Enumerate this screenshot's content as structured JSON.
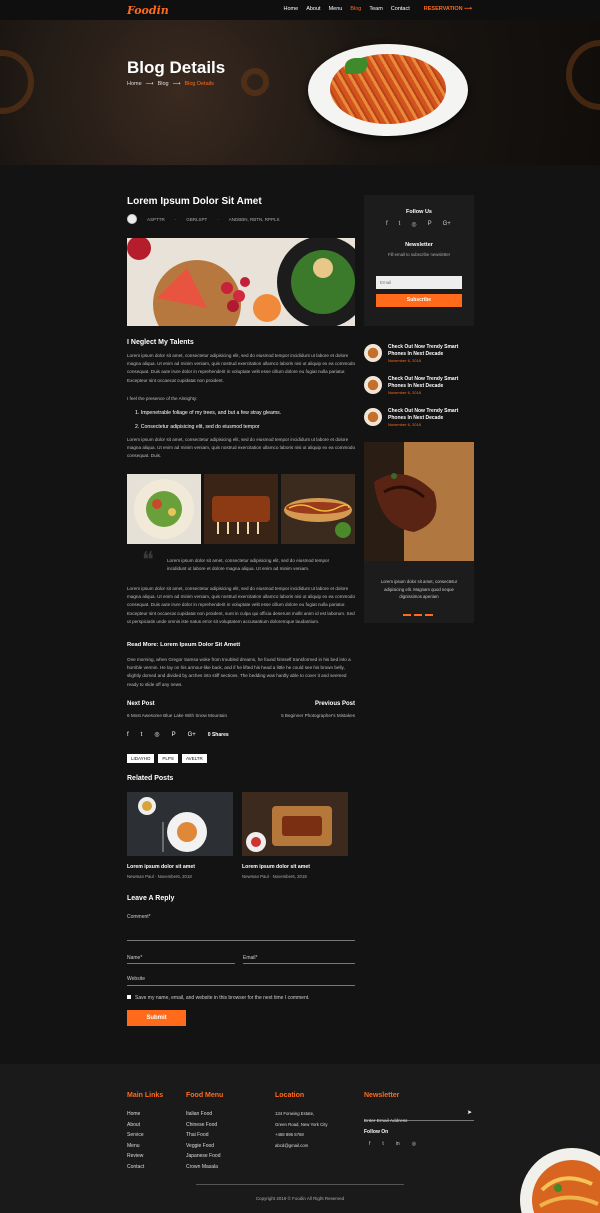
{
  "nav": {
    "logo": "Foodin",
    "links": [
      "Home",
      "About",
      "Menu",
      "Blog",
      "Team",
      "Contact"
    ],
    "active": "Blog",
    "reservation": "RESERVATION ⟶"
  },
  "hero": {
    "title": "Blog Details",
    "breadcrumb": [
      "Home",
      "Blog",
      "Blog Details"
    ]
  },
  "post": {
    "title": "Lorem Ipsum Dolor Sit Amet",
    "meta": [
      "ASPTTR",
      "GBRLSPT",
      "ANDBBN, RBTN, RPPLS"
    ],
    "section_title": "I Neglect My Talents",
    "para1": "Lorem ipsum dolor sit amet, consectetur adipisicing elit, sed do eiusmod tempor incididunt ut labore et dolore magna aliqua. Ut enim ad minim veniam, quis nostrud exercitation ullamco laboris nisi ut aliquip ex ea commodo consequat. Duis aute irure dolor in reprehenderit in voluptate velit esse cillum dolore eu fugiat nulla pariatur. Excepteur sint occaecat cupidatat non proident.",
    "presence": "I feel the presence of the Almighty:",
    "list": [
      "Impenetrable foliage of my trees, and but a few stray gleams.",
      "Consectetur adipisicing elit, sed do eiusmod tempor"
    ],
    "para2": "Lorem ipsum dolor sit amet, consectetur adipisicing elit, sed do eiusmod tempor incididunt ut labore et dolore magna aliqua. Ut enim ad minim veniam, quis nostrud exercitation ullamco laboris nisi ut aliquip ex ea commodo consequat. Duis.",
    "quote": "Lorem ipsum dolor sit amet, consectetur adipisicing elit, sed do eiusmod tempor incididunt ut labore et dolore magna aliqua. Ut enim ad minim veniam.",
    "para3": "Lorem ipsum dolor sit amet, consectetur adipisicing elit, sed do eiusmod tempor incididunt ut labore et dolore magna aliqua. Ut enim ad minim veniam, quis nostrud exercitation ullamco laboris nisi ut aliquip ex ea commodo consequat. Duis aute irure dolor in reprehenderit in voluptate velit esse cillum dolore eu fugiat nulla pariatur. Excepteur sint occaecat cupidatat non proident, sunt in culpa qui officia deserunt mollit anim id est laborum. Sed ut perspiciatis unde omnis iste natus error sit voluptatem accusantium doloremque laudantium.",
    "read_more": "Read More: Lorem Ipsum Dolor Sit Amett",
    "para4": "One morning, when Gregor Samsa woke from troubled dreams, he found himself transformed in his bed into a horrible vermin. He lay on his armour-like back, and if he lifted his head a little he could see his brown belly, slightly domed and divided by arches into stiff sections. The bedding was hardly able to cover it and seemed ready to slide off any news.",
    "next_label": "Next Post",
    "next_title": "6 Most Awesome Blue Lake With Snow Mountain",
    "prev_label": "Previous Post",
    "prev_title": "5 Beginner Photographer's Mistakes",
    "shares": "0 Shares",
    "tags": [
      "LIDAYHO",
      "PLPS",
      "AVELTR"
    ]
  },
  "related": {
    "heading": "Related Posts",
    "items": [
      {
        "title": "Lorem ipsum dolor sit amet",
        "meta": "Newman Paul · November6, 2018"
      },
      {
        "title": "Lorem ipsum dolor sit amet",
        "meta": "Newman Paul · November6, 2018"
      }
    ]
  },
  "reply": {
    "heading": "Leave A Reply",
    "comment": "Comment*",
    "name": "Name*",
    "email": "Email*",
    "website": "Website",
    "save": "Save my name, email, and website in this browser for the next time I comment.",
    "submit": "Submit"
  },
  "sidebar": {
    "follow": "Follow Us",
    "social": [
      "f",
      "t",
      "◎",
      "P",
      "G+"
    ],
    "newsletter": "Newsletter",
    "newsletter_sub": "Fill email to subscribe newsletter",
    "email_placeholder": "Email",
    "subscribe": "Subscribe",
    "recent": [
      {
        "title": "Check Out Now Trendy Smart Phones In Next Decade",
        "date": "November 6, 2018"
      },
      {
        "title": "Check Out Now Trendy Smart Phones In Next Decade",
        "date": "November 6, 2018"
      },
      {
        "title": "Check Out Now Trendy Smart Phones In Next Decade",
        "date": "November 6, 2018"
      }
    ],
    "testimonial": "Lorem ipsum dolor sit amet, consectetur adipisicing elit. Magnam quod neque dignissimos aperiam"
  },
  "footer": {
    "main_links_h": "Main Links",
    "main_links": [
      "Home",
      "About",
      "Service",
      "Menu",
      "Review",
      "Contact"
    ],
    "food_menu_h": "Food Menu",
    "food_menu": [
      "Italian Food",
      "Chinese Food",
      "Thai Food",
      "Veggie Food",
      "Japanese Food",
      "Crown Masala"
    ],
    "location_h": "Location",
    "location": [
      "134 Fonwing Estate,",
      "Green Road, New York City",
      "+468 896 5768",
      "abcd@gmail.com"
    ],
    "newsletter_h": "Newsletter",
    "newsletter_placeholder": "Enter Email Address",
    "follow_on": "Follow On",
    "social": [
      "f",
      "t",
      "in",
      "◎"
    ],
    "copyright": "Copyright 2019 © Foodin All Right Reserved"
  },
  "colors": {
    "accent": "#ff6b1a",
    "bg": "#131313"
  }
}
